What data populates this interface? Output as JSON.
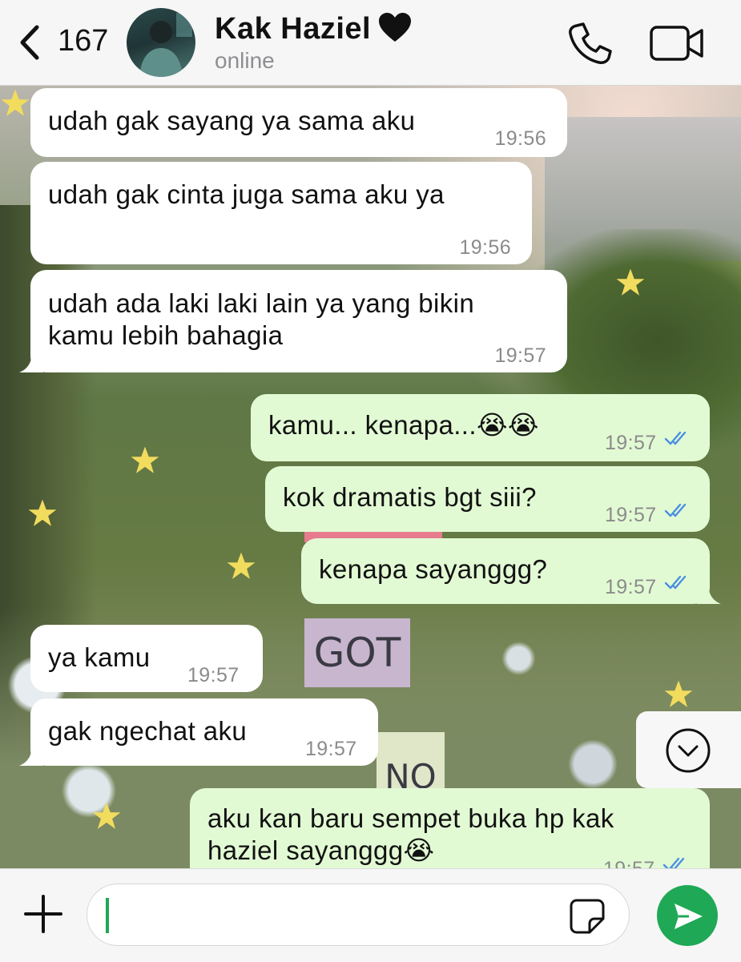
{
  "header": {
    "unread_count": "167",
    "contact_name": "Kak Haziel",
    "status": "online"
  },
  "messages": [
    {
      "direction": "in",
      "text": "udah gak sayang ya sama aku",
      "time": "19:56"
    },
    {
      "direction": "in",
      "text": "udah gak cinta juga sama aku ya",
      "time": "19:56"
    },
    {
      "direction": "in",
      "text": "udah ada laki laki lain ya yang bikin\nkamu lebih bahagia",
      "time": "19:57"
    },
    {
      "direction": "out",
      "text": "kamu... kenapa...😭😭",
      "time": "19:57",
      "read": true
    },
    {
      "direction": "out",
      "text": "kok dramatis bgt siii?",
      "time": "19:57",
      "read": true
    },
    {
      "direction": "out",
      "text": "kenapa sayanggg?",
      "time": "19:57",
      "read": true
    },
    {
      "direction": "in",
      "text": "ya kamu",
      "time": "19:57"
    },
    {
      "direction": "in",
      "text": "gak ngechat aku",
      "time": "19:57"
    },
    {
      "direction": "out",
      "text": "aku kan baru sempet buka hp kak\nhaziel sayanggg😭",
      "time": "19:57",
      "read": true
    }
  ],
  "wallpaper": {
    "sign_1": "GOT",
    "sign_2": "NO"
  },
  "composer": {
    "message_value": ""
  },
  "colors": {
    "accent": "#1fa855",
    "incoming_bubble": "#ffffff",
    "outgoing_bubble": "#e2fad4",
    "read_ticks": "#4a90e2"
  }
}
